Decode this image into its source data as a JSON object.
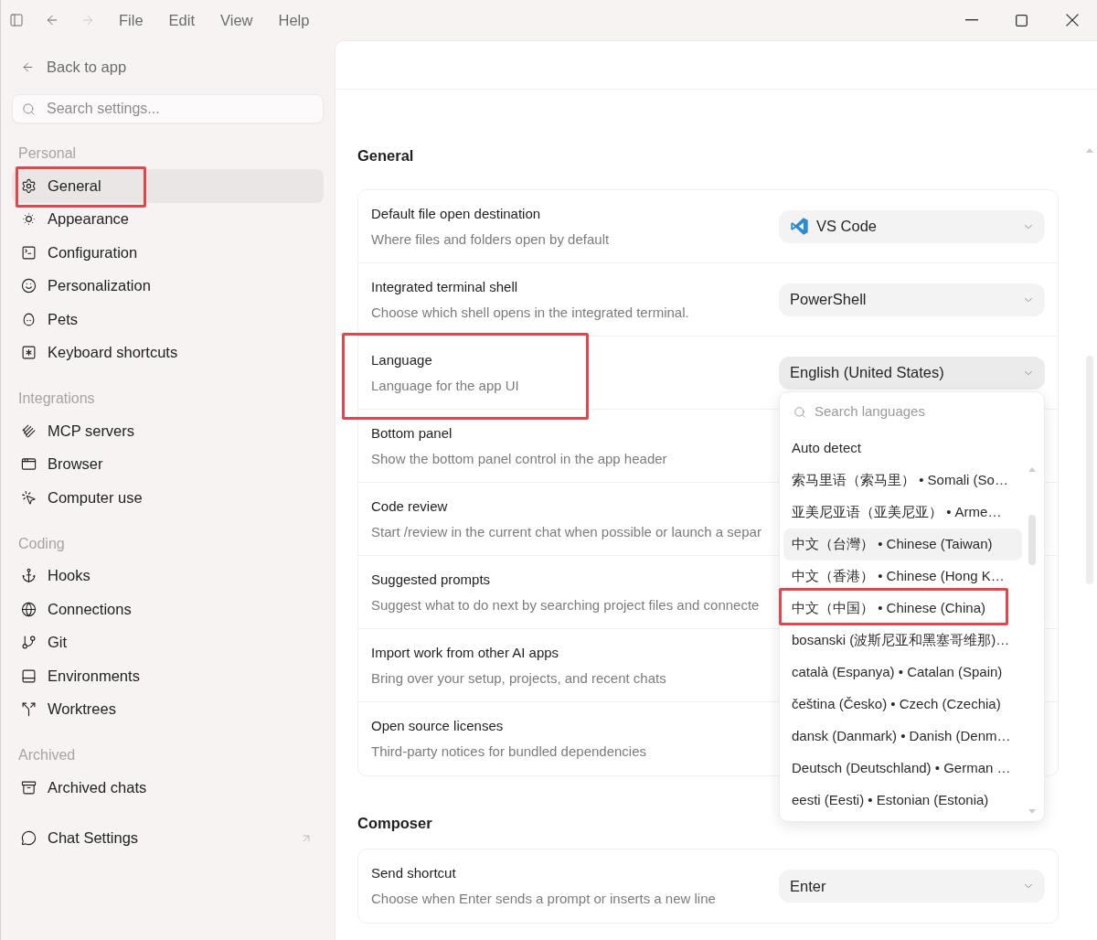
{
  "window": {
    "navigation": {
      "back": {
        "disabled": false
      },
      "forward": {
        "disabled": true
      }
    },
    "menu": [
      "File",
      "Edit",
      "View",
      "Help"
    ]
  },
  "sidebar": {
    "back_link": "Back to app",
    "search": {
      "placeholder": "Search settings..."
    },
    "groups": [
      {
        "heading": "Personal",
        "items": [
          {
            "label": "General",
            "selected": true,
            "annotated": true
          },
          {
            "label": "Appearance",
            "selected": false,
            "annotated": false
          },
          {
            "label": "Configuration",
            "selected": false,
            "annotated": false
          },
          {
            "label": "Personalization",
            "selected": false,
            "annotated": false
          },
          {
            "label": "Pets",
            "selected": false,
            "annotated": false
          },
          {
            "label": "Keyboard shortcuts",
            "selected": false,
            "annotated": false
          }
        ]
      },
      {
        "heading": "Integrations",
        "items": [
          {
            "label": "MCP servers",
            "selected": false,
            "annotated": false
          },
          {
            "label": "Browser",
            "selected": false,
            "annotated": false
          },
          {
            "label": "Computer use",
            "selected": false,
            "annotated": false
          }
        ]
      },
      {
        "heading": "Coding",
        "items": [
          {
            "label": "Hooks",
            "selected": false,
            "annotated": false
          },
          {
            "label": "Connections",
            "selected": false,
            "annotated": false
          },
          {
            "label": "Git",
            "selected": false,
            "annotated": false
          },
          {
            "label": "Environments",
            "selected": false,
            "annotated": false
          },
          {
            "label": "Worktrees",
            "selected": false,
            "annotated": false
          }
        ]
      },
      {
        "heading": "Archived",
        "items": [
          {
            "label": "Archived chats",
            "selected": false,
            "annotated": false
          }
        ]
      }
    ],
    "footer_link": {
      "label": "Chat Settings"
    }
  },
  "sections": [
    {
      "heading": "General",
      "rows": [
        {
          "title": "Default file open destination",
          "description": "Where files and folders open by default",
          "annotated": false,
          "control": {
            "kind": "app_select",
            "value": "VS Code"
          }
        },
        {
          "title": "Integrated terminal shell",
          "description": "Choose which shell opens in the integrated terminal.",
          "annotated": false,
          "control": {
            "kind": "select",
            "value": "PowerShell"
          }
        },
        {
          "title": "Language",
          "description": "Language for the app UI",
          "annotated": true,
          "control": {
            "kind": "select",
            "value": "English (United States)",
            "expanded": true,
            "menu": {
              "search": {
                "placeholder": "Search languages"
              },
              "options": [
                {
                  "label": "Auto detect",
                  "hovered": false,
                  "annotated": false
                },
                {
                  "label": "索马里语（索马里） • Somali (So…",
                  "hovered": false,
                  "annotated": false
                },
                {
                  "label": "亚美尼亚语（亚美尼亚） • Arme…",
                  "hovered": false,
                  "annotated": false
                },
                {
                  "label": "中文（台灣） • Chinese (Taiwan)",
                  "hovered": true,
                  "annotated": false
                },
                {
                  "label": "中文（香港） • Chinese (Hong K…",
                  "hovered": false,
                  "annotated": false
                },
                {
                  "label": "中文（中国） • Chinese (China)",
                  "hovered": false,
                  "annotated": true
                },
                {
                  "label": "bosanski (波斯尼亚和黑塞哥维那)…",
                  "hovered": false,
                  "annotated": false
                },
                {
                  "label": "català (Espanya) • Catalan (Spain)",
                  "hovered": false,
                  "annotated": false
                },
                {
                  "label": "čeština (Česko) • Czech (Czechia)",
                  "hovered": false,
                  "annotated": false
                },
                {
                  "label": "dansk (Danmark) • Danish (Denm…",
                  "hovered": false,
                  "annotated": false
                },
                {
                  "label": "Deutsch (Deutschland) • German …",
                  "hovered": false,
                  "annotated": false
                },
                {
                  "label": "eesti (Eesti) • Estonian (Estonia)",
                  "hovered": false,
                  "annotated": false
                }
              ]
            }
          }
        },
        {
          "title": "Bottom panel",
          "description": "Show the bottom panel control in the app header",
          "annotated": false
        },
        {
          "title": "Code review",
          "description": "Start /review in the current chat when possible or launch a separ",
          "annotated": false
        },
        {
          "title": "Suggested prompts",
          "description": "Suggest what to do next by searching project files and connecte",
          "annotated": false
        },
        {
          "title": "Import work from other AI apps",
          "description": "Bring over your setup, projects, and recent chats",
          "annotated": false
        },
        {
          "title": "Open source licenses",
          "description": "Third-party notices for bundled dependencies",
          "annotated": false
        }
      ]
    },
    {
      "heading": "Composer",
      "rows": [
        {
          "title": "Send shortcut",
          "description": "Choose when Enter sends a prompt or inserts a new line",
          "annotated": false,
          "control": {
            "kind": "select",
            "value": "Enter"
          }
        }
      ]
    }
  ]
}
